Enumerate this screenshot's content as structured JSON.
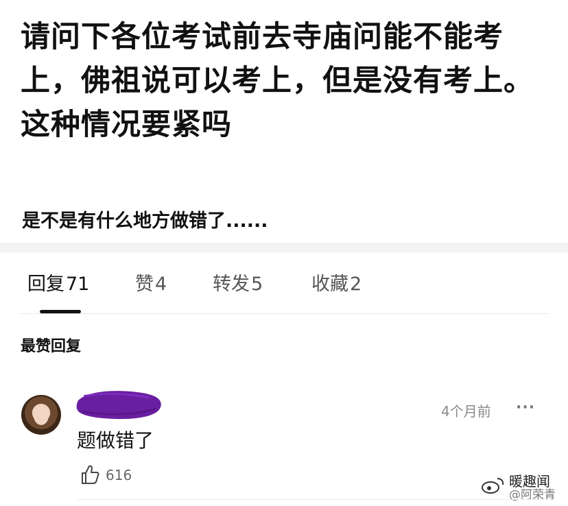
{
  "post": {
    "title": "请问下各位考试前去寺庙问能不能考上，佛祖说可以考上，但是没有考上。这种情况要紧吗",
    "body": "是不是有什么地方做错了......"
  },
  "tabs": [
    {
      "label": "回复",
      "count": "71",
      "active": true
    },
    {
      "label": "赞",
      "count": "4",
      "active": false
    },
    {
      "label": "转发",
      "count": "5",
      "active": false
    },
    {
      "label": "收藏",
      "count": "2",
      "active": false
    }
  ],
  "section_title": "最赞回复",
  "comment": {
    "time": "4个月前",
    "more_icon": "···",
    "text": "题做错了",
    "likes": "616"
  },
  "watermark": {
    "line1": "暖趣闻",
    "line2": "@阿荣青"
  },
  "colors": {
    "redaction": "#6a1fa0",
    "band": "#f3f3f3",
    "active_tab": "#111111",
    "inactive_tab": "#555555"
  }
}
